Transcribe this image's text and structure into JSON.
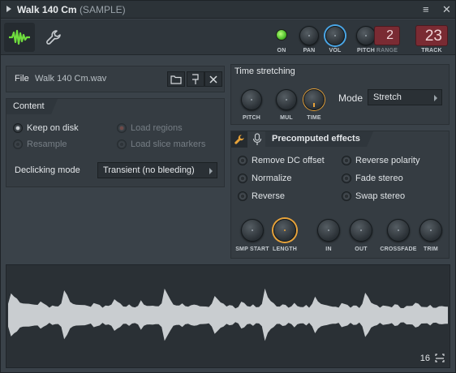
{
  "window": {
    "title": "Walk 140 Cm",
    "subtitle": "(SAMPLE)",
    "close_glyph": "✕",
    "menu_glyph": "≡"
  },
  "toolbar": {
    "on_label": "ON",
    "pan_label": "PAN",
    "vol_label": "VOL",
    "pitch_label": "PITCH",
    "range_label": "RANGE",
    "range_value": "2",
    "track_label": "TRACK",
    "track_value": "23",
    "on_color": "#6fdc3e",
    "vol_ring_color": "#4aa7e8"
  },
  "file": {
    "label": "File",
    "filename": "Walk 140 Cm.wav"
  },
  "content": {
    "title": "Content",
    "keep_on_disk": "Keep on disk",
    "load_regions": "Load regions",
    "resample": "Resample",
    "load_slice_markers": "Load slice markers",
    "declicking_label": "Declicking mode",
    "declicking_value": "Transient (no bleeding)"
  },
  "time_stretching": {
    "title": "Time stretching",
    "pitch_label": "PITCH",
    "mul_label": "MUL",
    "time_label": "TIME",
    "mode_label": "Mode",
    "mode_value": "Stretch"
  },
  "precomputed": {
    "title": "Precomputed effects",
    "options": [
      "Remove DC offset",
      "Reverse polarity",
      "Normalize",
      "Fade stereo",
      "Reverse",
      "Swap stereo"
    ],
    "knobs": [
      "SMP START",
      "LENGTH",
      "IN",
      "OUT",
      "CROSSFADE",
      "TRIM"
    ],
    "accent_color": "#e8a33a"
  },
  "waveform": {
    "zoom_value": "16",
    "wave_color": "#c9cdd0",
    "envelope": [
      0.3,
      0.55,
      0.45,
      0.38,
      0.32,
      0.28,
      0.26,
      0.3,
      0.27,
      0.24,
      0.22,
      0.35,
      0.28,
      0.22,
      0.2,
      0.24,
      0.2,
      0.18,
      0.3,
      0.62,
      0.48,
      0.35,
      0.28,
      0.24,
      0.22,
      0.26,
      0.24,
      0.2,
      0.22,
      0.3,
      0.26,
      0.22,
      0.19,
      0.23,
      0.2,
      0.28,
      0.4,
      0.32,
      0.26,
      0.22,
      0.2,
      0.24,
      0.22,
      0.19,
      0.21,
      0.34,
      0.27,
      0.22,
      0.2,
      0.25,
      0.22,
      0.2,
      0.26,
      0.68,
      0.52,
      0.36,
      0.28,
      0.24,
      0.22,
      0.26,
      0.23,
      0.2,
      0.22,
      0.28,
      0.25,
      0.2,
      0.18,
      0.22,
      0.19,
      0.26,
      0.5,
      0.4,
      0.3,
      0.25,
      0.22,
      0.24,
      0.21,
      0.18,
      0.2,
      0.32,
      0.27,
      0.23,
      0.2,
      0.24,
      0.21,
      0.2,
      0.26,
      0.64,
      0.46,
      0.34,
      0.27,
      0.23,
      0.21,
      0.25,
      0.22,
      0.19,
      0.21,
      0.28,
      0.24,
      0.2,
      0.18,
      0.22,
      0.19,
      0.27,
      0.44,
      0.36,
      0.28,
      0.24,
      0.21,
      0.23,
      0.2,
      0.18,
      0.2,
      0.3,
      0.26,
      0.22,
      0.19,
      0.23,
      0.21,
      0.19,
      0.28,
      0.55,
      0.42,
      0.32,
      0.26,
      0.22,
      0.2,
      0.24,
      0.21,
      0.18,
      0.2,
      0.26,
      0.23,
      0.19,
      0.17,
      0.21,
      0.19,
      0.24,
      0.3,
      0.26,
      0.22,
      0.2,
      0.18,
      0.22,
      0.19,
      0.17,
      0.19,
      0.24,
      0.21,
      0.19
    ]
  }
}
